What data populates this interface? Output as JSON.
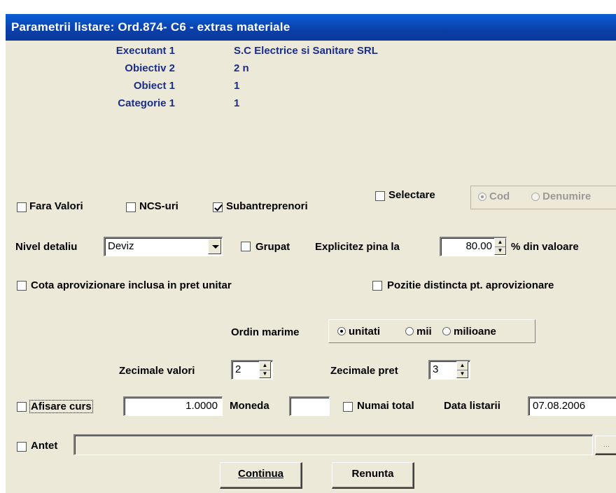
{
  "window": {
    "title": "Parametrii listare: Ord.874- C6 - extras materiale"
  },
  "info": [
    {
      "label": "Executant 1",
      "value": "S.C Electrice si Sanitare SRL"
    },
    {
      "label": "Obiectiv 2",
      "value": "2 n"
    },
    {
      "label": "Obiect 1",
      "value": "1"
    },
    {
      "label": "Categorie 1",
      "value": "1"
    }
  ],
  "options": {
    "fara_valori": {
      "label": "Fara Valori",
      "checked": false
    },
    "ncs_uri": {
      "label": "NCS-uri",
      "checked": false
    },
    "subantreprenori": {
      "label": "Subantreprenori",
      "checked": true
    },
    "selectare": {
      "label": "Selectare",
      "checked": false
    },
    "sort": {
      "cod": "Cod",
      "denumire": "Denumire",
      "selected": "Cod",
      "enabled": false
    }
  },
  "nivel_detaliu": {
    "label": "Nivel detaliu",
    "value": "Deviz"
  },
  "grupat": {
    "label": "Grupat",
    "checked": false
  },
  "explicitez": {
    "label": "Explicitez pina la",
    "value": "80.00",
    "suffix": "% din valoare"
  },
  "cota_aprovizionare": {
    "label": "Cota aprovizionare inclusa in pret unitar",
    "checked": false
  },
  "pozitie_distincta": {
    "label": "Pozitie distincta pt. aprovizionare",
    "checked": false
  },
  "ordin_marime": {
    "label": "Ordin marime",
    "options": [
      "unitati",
      "mii",
      "milioane"
    ],
    "selected": "unitati"
  },
  "zecimale_valori": {
    "label": "Zecimale valori",
    "value": "2"
  },
  "zecimale_pret": {
    "label": "Zecimale pret",
    "value": "3"
  },
  "afisare_curs": {
    "label": "Afisare curs",
    "checked": false,
    "value": "1.0000"
  },
  "moneda": {
    "label": "Moneda",
    "value": ""
  },
  "numai_total": {
    "label": "Numai total",
    "checked": false
  },
  "data_listarii": {
    "label": "Data listarii",
    "value": "07.08.2006"
  },
  "antet": {
    "label": "Antet",
    "checked": false,
    "value": "",
    "browse_label": "..."
  },
  "buttons": {
    "continua": "Continua",
    "renunta": "Renunta"
  }
}
